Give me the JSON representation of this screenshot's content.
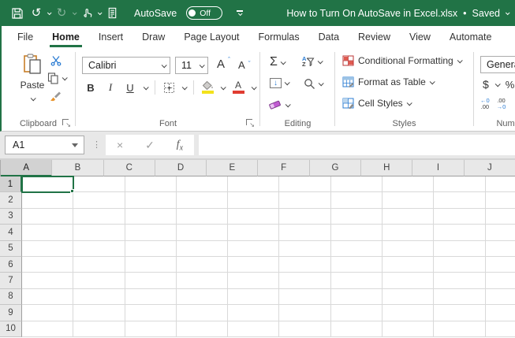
{
  "colors": {
    "accent": "#217346",
    "titlebar": "#217346",
    "cut_blue": "#2b7cd3",
    "fill_yellow": "#f3e21c",
    "font_red": "#e03c31",
    "eraser_purple": "#c05ad1"
  },
  "titlebar": {
    "icons": [
      "save-icon",
      "undo-icon",
      "redo-icon",
      "touch-mode-icon",
      "print-preview-icon"
    ],
    "autosave_label": "AutoSave",
    "autosave_state": "Off",
    "title": "How to Turn On AutoSave in Excel.xlsx",
    "separator": "•",
    "saved_status": "Saved"
  },
  "tabs": {
    "items": [
      {
        "label": "File",
        "active": false
      },
      {
        "label": "Home",
        "active": true
      },
      {
        "label": "Insert",
        "active": false
      },
      {
        "label": "Draw",
        "active": false
      },
      {
        "label": "Page Layout",
        "active": false
      },
      {
        "label": "Formulas",
        "active": false
      },
      {
        "label": "Data",
        "active": false
      },
      {
        "label": "Review",
        "active": false
      },
      {
        "label": "View",
        "active": false
      },
      {
        "label": "Automate",
        "active": false
      }
    ]
  },
  "ribbon": {
    "clipboard": {
      "label": "Clipboard",
      "paste_label": "Paste"
    },
    "font": {
      "label": "Font",
      "font_name": "Calibri",
      "font_size": "11",
      "bold": "B",
      "italic": "I",
      "underline": "U",
      "font_color_letter": "A"
    },
    "editing": {
      "label": "Editing",
      "autosum": "Σ"
    },
    "styles": {
      "label": "Styles",
      "items": [
        "Conditional Formatting",
        "Format as Table",
        "Cell Styles"
      ]
    },
    "number": {
      "label": "Number",
      "format": "General",
      "currency": "$",
      "percent": "%",
      "dec_top_left": "←0",
      "dec_bot_left": ".00",
      "dec_top_right": ".00",
      "dec_bot_right": "→0"
    }
  },
  "formula_bar": {
    "name_box": "A1",
    "cancel": "×",
    "enter": "✓",
    "fx_f": "f",
    "fx_x": "x",
    "formula_value": ""
  },
  "grid": {
    "columns": [
      "A",
      "B",
      "C",
      "D",
      "E",
      "F",
      "G",
      "H",
      "I",
      "J"
    ],
    "rows": [
      "1",
      "2",
      "3",
      "4",
      "5",
      "6",
      "7",
      "8",
      "9",
      "10"
    ],
    "selected_column": "A",
    "selected_row": "1",
    "selected_cell": "A1"
  }
}
